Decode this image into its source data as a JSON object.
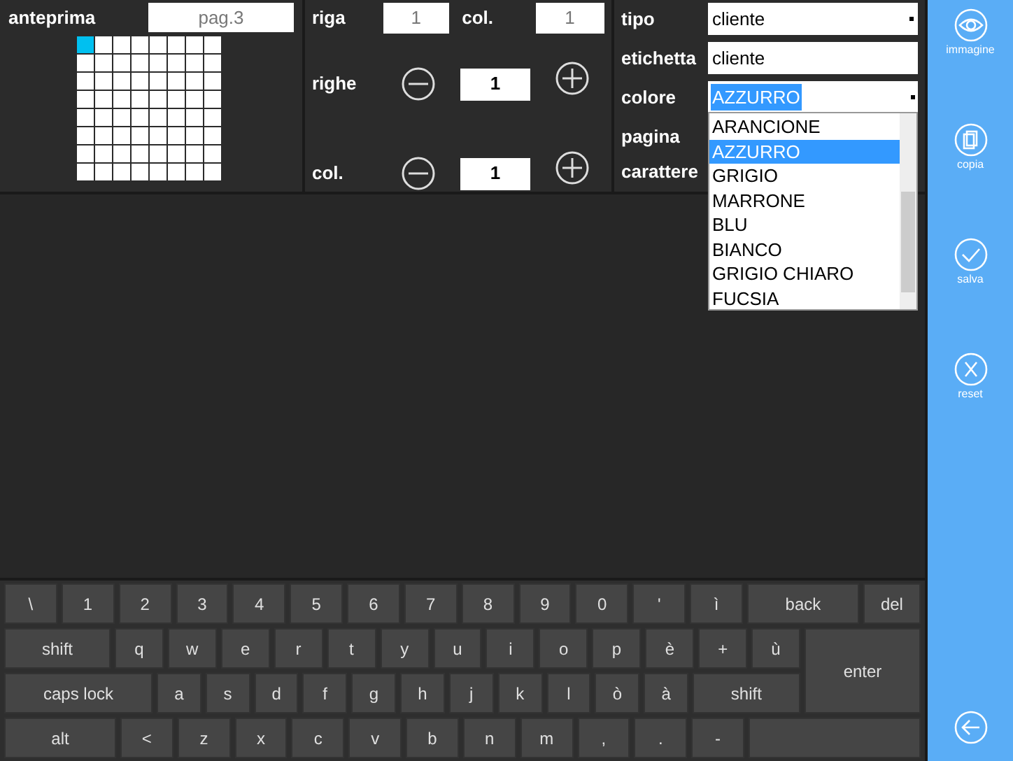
{
  "preview": {
    "label": "anteprima",
    "page": "pag.3",
    "grid": [
      [
        {
          "selected": true
        },
        {
          "selected": false
        },
        {
          "selected": false
        },
        {
          "selected": false
        },
        {
          "selected": false
        },
        {
          "selected": false
        },
        {
          "selected": false
        },
        {
          "selected": false
        }
      ],
      [
        {
          "selected": false
        },
        {
          "selected": false
        },
        {
          "selected": false
        },
        {
          "selected": false
        },
        {
          "selected": false
        },
        {
          "selected": false
        },
        {
          "selected": false
        },
        {
          "selected": false
        }
      ],
      [
        {
          "selected": false
        },
        {
          "selected": false
        },
        {
          "selected": false
        },
        {
          "selected": false
        },
        {
          "selected": false
        },
        {
          "selected": false
        },
        {
          "selected": false
        },
        {
          "selected": false
        }
      ],
      [
        {
          "selected": false
        },
        {
          "selected": false
        },
        {
          "selected": false
        },
        {
          "selected": false
        },
        {
          "selected": false
        },
        {
          "selected": false
        },
        {
          "selected": false
        },
        {
          "selected": false
        }
      ],
      [
        {
          "selected": false
        },
        {
          "selected": false
        },
        {
          "selected": false
        },
        {
          "selected": false
        },
        {
          "selected": false
        },
        {
          "selected": false
        },
        {
          "selected": false
        },
        {
          "selected": false
        }
      ],
      [
        {
          "selected": false
        },
        {
          "selected": false
        },
        {
          "selected": false
        },
        {
          "selected": false
        },
        {
          "selected": false
        },
        {
          "selected": false
        },
        {
          "selected": false
        },
        {
          "selected": false
        }
      ],
      [
        {
          "selected": false
        },
        {
          "selected": false
        },
        {
          "selected": false
        },
        {
          "selected": false
        },
        {
          "selected": false
        },
        {
          "selected": false
        },
        {
          "selected": false
        },
        {
          "selected": false
        }
      ],
      [
        {
          "selected": false
        },
        {
          "selected": false
        },
        {
          "selected": false
        },
        {
          "selected": false
        },
        {
          "selected": false
        },
        {
          "selected": false
        },
        {
          "selected": false
        },
        {
          "selected": false
        }
      ]
    ]
  },
  "position": {
    "row_label": "riga",
    "row_value": "1",
    "col_label": "col.",
    "col_value": "1"
  },
  "steppers": [
    {
      "label": "righe",
      "value": "1"
    },
    {
      "label": "col.",
      "value": "1"
    }
  ],
  "properties": {
    "tipo_label": "tipo",
    "tipo_value": "cliente",
    "etichetta_label": "etichetta",
    "etichetta_value": "cliente",
    "colore_label": "colore",
    "colore_value": "AZZURRO",
    "pagina_label": "pagina",
    "carattere_label": "carattere",
    "colore_options": [
      {
        "label": "ARANCIONE",
        "selected": false
      },
      {
        "label": "AZZURRO",
        "selected": true
      },
      {
        "label": "GRIGIO",
        "selected": false
      },
      {
        "label": "MARRONE",
        "selected": false
      },
      {
        "label": "BLU",
        "selected": false
      },
      {
        "label": "BIANCO",
        "selected": false
      },
      {
        "label": "GRIGIO CHIARO",
        "selected": false
      },
      {
        "label": "FUCSIA",
        "selected": false
      }
    ]
  },
  "sidebar": [
    {
      "kind": "eye",
      "label": "immagine"
    },
    {
      "kind": "copy",
      "label": "copia"
    },
    {
      "kind": "check",
      "label": "salva"
    },
    {
      "kind": "close",
      "label": "reset"
    }
  ],
  "keyboard": [
    [
      {
        "kind": "char",
        "label": "\\"
      },
      {
        "kind": "char",
        "label": "1"
      },
      {
        "kind": "char",
        "label": "2"
      },
      {
        "kind": "char",
        "label": "3"
      },
      {
        "kind": "char",
        "label": "4"
      },
      {
        "kind": "char",
        "label": "5"
      },
      {
        "kind": "char",
        "label": "6"
      },
      {
        "kind": "char",
        "label": "7"
      },
      {
        "kind": "char",
        "label": "8"
      },
      {
        "kind": "char",
        "label": "9"
      },
      {
        "kind": "char",
        "label": "0"
      },
      {
        "kind": "char",
        "label": "'"
      },
      {
        "kind": "char",
        "label": "ì"
      },
      {
        "kind": "back",
        "label": "back"
      },
      {
        "kind": "del",
        "label": "del"
      }
    ],
    [
      {
        "kind": "shift",
        "label": "shift"
      },
      {
        "kind": "char",
        "label": "q"
      },
      {
        "kind": "char",
        "label": "w"
      },
      {
        "kind": "char",
        "label": "e"
      },
      {
        "kind": "char",
        "label": "r"
      },
      {
        "kind": "char",
        "label": "t"
      },
      {
        "kind": "char",
        "label": "y"
      },
      {
        "kind": "char",
        "label": "u"
      },
      {
        "kind": "char",
        "label": "i"
      },
      {
        "kind": "char",
        "label": "o"
      },
      {
        "kind": "char",
        "label": "p"
      },
      {
        "kind": "char",
        "label": "è"
      },
      {
        "kind": "char",
        "label": "+"
      },
      {
        "kind": "char",
        "label": "ù"
      }
    ],
    [
      {
        "kind": "caps",
        "label": "caps lock"
      },
      {
        "kind": "char",
        "label": "a"
      },
      {
        "kind": "char",
        "label": "s"
      },
      {
        "kind": "char",
        "label": "d"
      },
      {
        "kind": "char",
        "label": "f"
      },
      {
        "kind": "char",
        "label": "g"
      },
      {
        "kind": "char",
        "label": "h"
      },
      {
        "kind": "char",
        "label": "j"
      },
      {
        "kind": "char",
        "label": "k"
      },
      {
        "kind": "char",
        "label": "l"
      },
      {
        "kind": "char",
        "label": "ò"
      },
      {
        "kind": "char",
        "label": "à"
      },
      {
        "kind": "rshift",
        "label": "shift"
      }
    ],
    [
      {
        "kind": "alt",
        "label": "alt"
      },
      {
        "kind": "char",
        "label": "<"
      },
      {
        "kind": "char",
        "label": "z"
      },
      {
        "kind": "char",
        "label": "x"
      },
      {
        "kind": "char",
        "label": "c"
      },
      {
        "kind": "char",
        "label": "v"
      },
      {
        "kind": "char",
        "label": "b"
      },
      {
        "kind": "char",
        "label": "n"
      },
      {
        "kind": "char",
        "label": "m"
      },
      {
        "kind": "char",
        "label": ","
      },
      {
        "kind": "char",
        "label": "."
      },
      {
        "kind": "char",
        "label": "-"
      },
      {
        "kind": "blank"
      }
    ]
  ],
  "enter_key": {
    "label": "enter"
  }
}
